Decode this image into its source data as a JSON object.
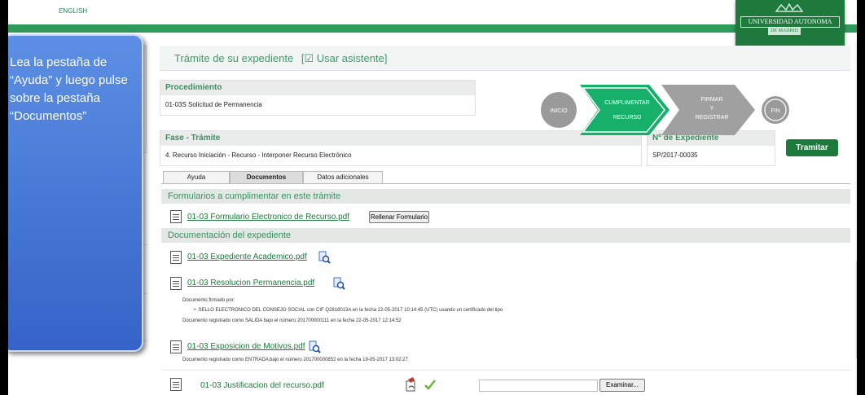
{
  "topbar": {
    "language_link": "ENGLISH"
  },
  "logo": {
    "line1": "UNIVERSIDAD AUTONOMA",
    "line2": "DE MADRID"
  },
  "header": {
    "title": "Trámite de su expediente",
    "assistant_toggle": "[☑ Usar asistente]"
  },
  "procedimiento": {
    "label": "Procedimiento",
    "value": "01-03S Solicitud de Permanencia"
  },
  "fase": {
    "label": "Fase - Trámite",
    "value": "4. Recurso Iniciación - Recurso - Interponer Recurso Electrónico"
  },
  "expediente": {
    "label": "Nº de Expediente",
    "value": "SP/2017-00035"
  },
  "steps": [
    {
      "label": "INICIO"
    },
    {
      "label": "CUMPLIMENTAR",
      "label2": "RECURSO"
    },
    {
      "label": "FIRMAR",
      "label2": "Y",
      "label3": "REGISTRAR"
    },
    {
      "label": "FIN"
    }
  ],
  "tramitar_button": "Tramitar",
  "tabs": [
    "Ayuda",
    "Documentos",
    "Datos adicionales"
  ],
  "section_forms": "Formularios a cumplimentar en este trámite",
  "form_doc": {
    "name": "01-03 Formulario Electronico de Recurso.pdf",
    "button": "Rellenar Formulario"
  },
  "section_docs": "Documentación del expediente",
  "docs": {
    "d1": {
      "name": "01-03 Expediente Academico.pdf"
    },
    "d2": {
      "name": "01-03 Resolucion Permanencia.pdf",
      "signed_by": "Documento firmado por:",
      "signer": "SELLO ELECTRONICO DEL CONSEJO SOCIAL con CIF Q2818013A en la fecha 22-05-2017 10:14:45 (UTC) usando un certificado del tipo",
      "registry": "Documento registrado como SALIDA bajo el número 201700000111 en la fecha 22-05-2017 12:14:52"
    },
    "d3": {
      "name": "01-03 Exposicion de Motivos.pdf",
      "registry": "Documento registrado como ENTRADA bajo el número 201700000852 en la fecha 19-05-2017 13:02:27"
    },
    "d4": {
      "name": "01-03 Justificacion del recurso.pdf",
      "browse_button": "Examinar..."
    }
  },
  "callout": {
    "text": "Lea la pestaña de “Ayuda” y luego pulse sobre la pestaña “Documentos”"
  },
  "colors": {
    "brand_green": "#1e7a3c",
    "accent_green": "#2e9b5b",
    "callout_blue": "#3f6fd3"
  }
}
